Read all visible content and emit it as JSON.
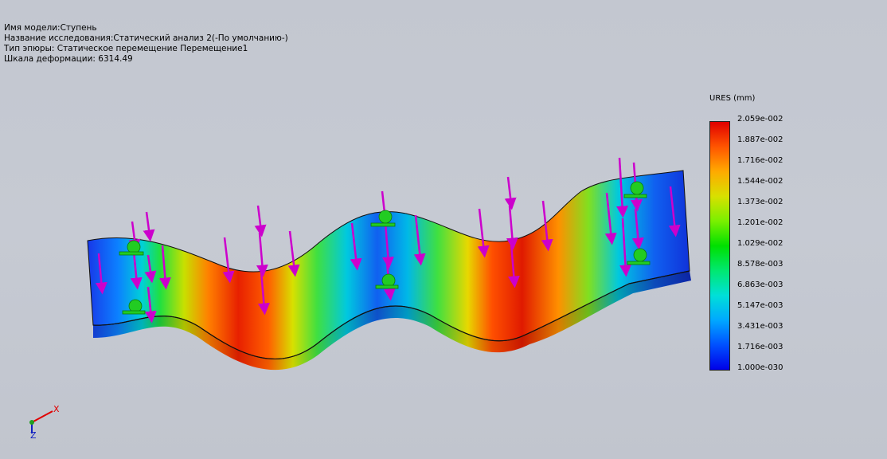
{
  "info": {
    "model": "Имя модели:Ступень",
    "study": "Название исследования:Статический анализ 2(-По умолчанию-)",
    "plot_type": "Тип эпюры: Статическое перемещение Перемещение1",
    "deformation_scale": "Шкала деформации: 6314.49"
  },
  "legend": {
    "title": "URES (mm)",
    "labels": [
      "2.059e-002",
      "1.887e-002",
      "1.716e-002",
      "1.544e-002",
      "1.373e-002",
      "1.201e-002",
      "1.029e-002",
      "8.578e-003",
      "6.863e-003",
      "5.147e-003",
      "3.431e-003",
      "1.716e-003",
      "1.000e-030"
    ]
  },
  "triad": {
    "x_label": "X",
    "z_label": "Z"
  },
  "colors": {
    "max": "#e00000",
    "min": "#0000e8",
    "load_arrow": "#cc00cc",
    "fixture": "#22cc22"
  }
}
